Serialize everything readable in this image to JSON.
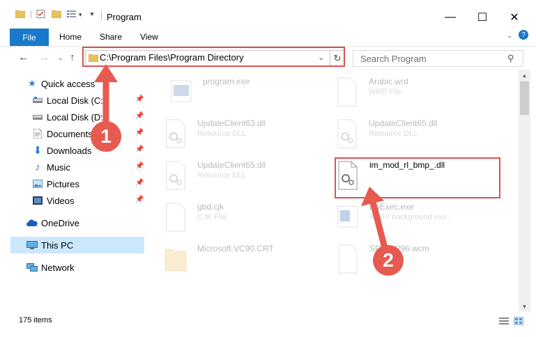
{
  "window": {
    "title": "Program",
    "minimize": "—",
    "maximize": "☐",
    "close": "✕"
  },
  "ribbon": {
    "tabs": [
      "File",
      "Home",
      "Share",
      "View"
    ],
    "help": "?"
  },
  "address": {
    "path": "C:\\Program Files\\Program Directory",
    "search_placeholder": "Search Program"
  },
  "sidebar": {
    "items": [
      {
        "label": "Quick access",
        "icon": "star-icon"
      },
      {
        "label": "Local Disk (C:)",
        "icon": "drive-icon"
      },
      {
        "label": "Local Disk (D:)",
        "icon": "drive-icon"
      },
      {
        "label": "Documents",
        "icon": "document-icon"
      },
      {
        "label": "Downloads",
        "icon": "download-icon"
      },
      {
        "label": "Music",
        "icon": "music-icon"
      },
      {
        "label": "Pictures",
        "icon": "picture-icon"
      },
      {
        "label": "Videos",
        "icon": "video-icon"
      },
      {
        "label": "OneDrive",
        "icon": "cloud-icon"
      },
      {
        "label": "This PC",
        "icon": "computer-icon"
      },
      {
        "label": "Network",
        "icon": "network-icon"
      }
    ]
  },
  "files": [
    {
      "name": "program.exe",
      "type": ""
    },
    {
      "name": "Arabic.wrd",
      "type": "WRD File"
    },
    {
      "name": "UpdateClient63.dll",
      "type": "Resource DLL"
    },
    {
      "name": "UpdateClient65.dll",
      "type": "Resource DLL"
    },
    {
      "name": "UpdateClient65.dll",
      "type": "Resource DLL"
    },
    {
      "name": "im_mod_rl_bmp_.dll",
      "type": ""
    },
    {
      "name": "gbd.cjk",
      "type": "CJK File"
    },
    {
      "name": "BgExec.exe",
      "type": "ABBY background exe..."
    },
    {
      "name": "Microsoft.VC90.CRT",
      "type": ""
    },
    {
      "name": "SRWNP96.wcm",
      "type": "...e"
    }
  ],
  "annotations": {
    "step1": "1",
    "step2": "2",
    "color": "#e65a4f"
  },
  "status": {
    "items_count": "175 items"
  },
  "colors": {
    "accent": "#1979ca",
    "selection": "#cce8ff",
    "highlight_border": "#e05050"
  }
}
